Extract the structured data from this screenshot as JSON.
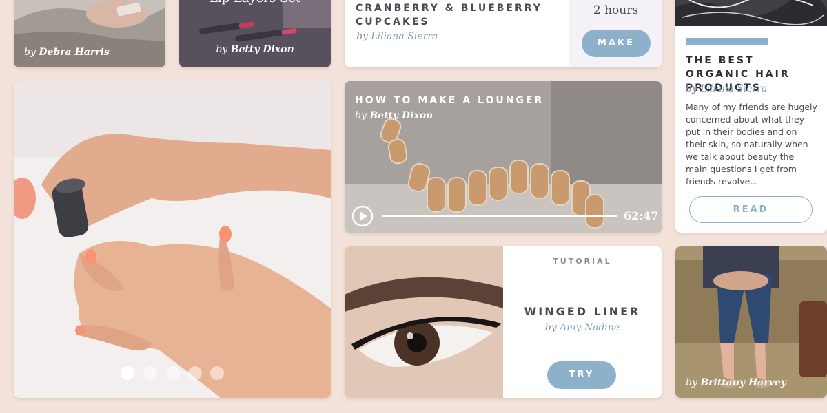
{
  "cards": {
    "phone": {
      "by": "by",
      "author": "Debra Harris"
    },
    "lips": {
      "title": "Lip Layers Set",
      "by": "by",
      "author": "Betty Dixon"
    },
    "recipe": {
      "title": "CRANBERRY & BLUEBERRY CUPCAKES",
      "by": "by",
      "author": "Liliana Sierra",
      "duration": "2 hours",
      "button": "MAKE"
    },
    "article": {
      "title": "THE BEST ORGANIC HAIR PRODUCTS",
      "by": "by",
      "author": "Liliana Sierra",
      "excerpt": "Many of my friends are hugely concerned about what they put in their bodies and on their skin, so naturally when we talk about beauty the main questions I get from friends revolve...",
      "button": "READ"
    },
    "video": {
      "title": "HOW TO MAKE A LOUNGER",
      "by": "by",
      "author": "Betty Dixon",
      "time": "62:47"
    },
    "slider": {
      "slides": 5,
      "active": 1
    },
    "tutorial": {
      "kicker": "TUTORIAL",
      "title": "WINGED LINER",
      "by": "by",
      "author": "Amy Nadine",
      "button": "TRY"
    },
    "portrait": {
      "by": "by",
      "author": "Brittany Harvey"
    }
  },
  "colors": {
    "background": "#f2e2da",
    "accent": "#8db0cb",
    "heading": "#4a4a55",
    "author_link": "#7ea3bf"
  }
}
